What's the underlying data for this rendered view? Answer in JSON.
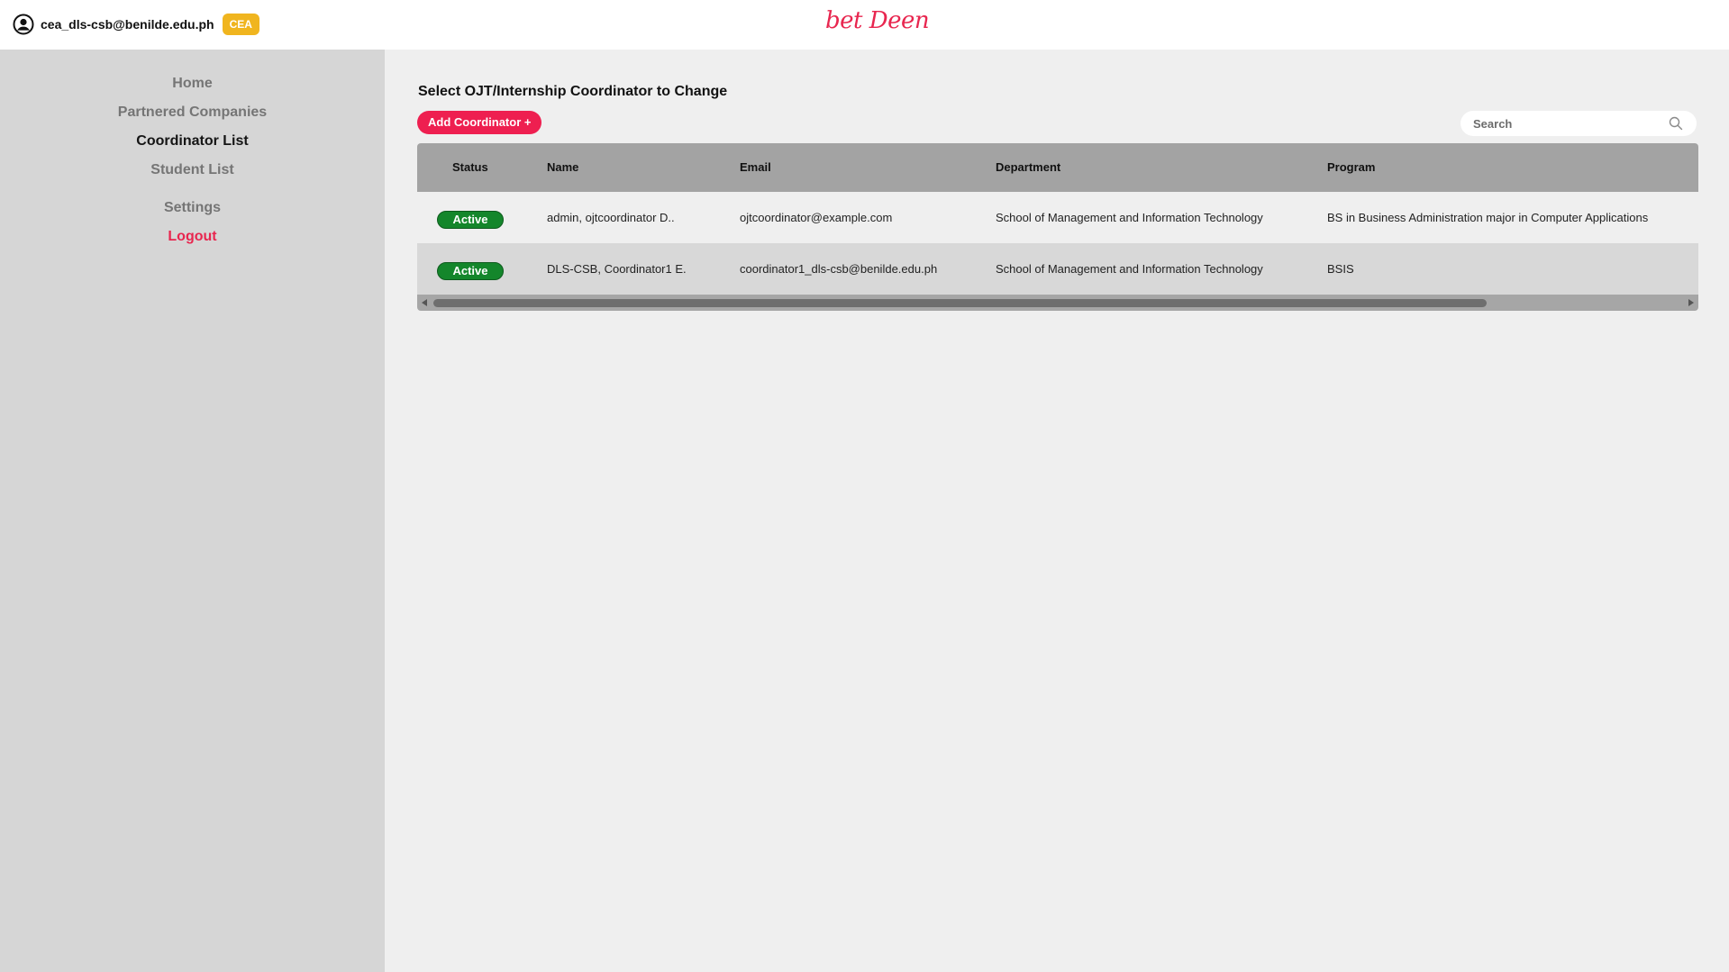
{
  "header": {
    "user_email": "cea_dls-csb@benilde.edu.ph",
    "role_badge": "CEA",
    "logo_text": "bet Deen",
    "logo_color": "#e8264f"
  },
  "sidebar": {
    "items": [
      {
        "label": "Home",
        "active": false
      },
      {
        "label": "Partnered Companies",
        "active": false
      },
      {
        "label": "Coordinator List",
        "active": true
      },
      {
        "label": "Student List",
        "active": false
      },
      {
        "label": "Settings",
        "active": false
      },
      {
        "label": "Logout",
        "active": false
      }
    ]
  },
  "main": {
    "title": "Select OJT/Internship Coordinator to Change",
    "add_button_label": "Add Coordinator +",
    "search_placeholder": "Search",
    "table": {
      "columns": [
        "Status",
        "Name",
        "Email",
        "Department",
        "Program"
      ],
      "rows": [
        {
          "status": "Active",
          "name": "admin, ojtcoordinator D..",
          "email": "ojtcoordinator@example.com",
          "department": "School of Management and Information Technology",
          "program": "BS in Business Administration major in Computer Applications"
        },
        {
          "status": "Active",
          "name": "DLS-CSB, Coordinator1 E.",
          "email": "coordinator1_dls-csb@benilde.edu.ph",
          "department": "School of Management and Information Technology",
          "program": "BSIS"
        }
      ]
    }
  },
  "colors": {
    "accent": "#ee1f50",
    "status_active": "#14862b",
    "badge": "#f0b51f"
  }
}
